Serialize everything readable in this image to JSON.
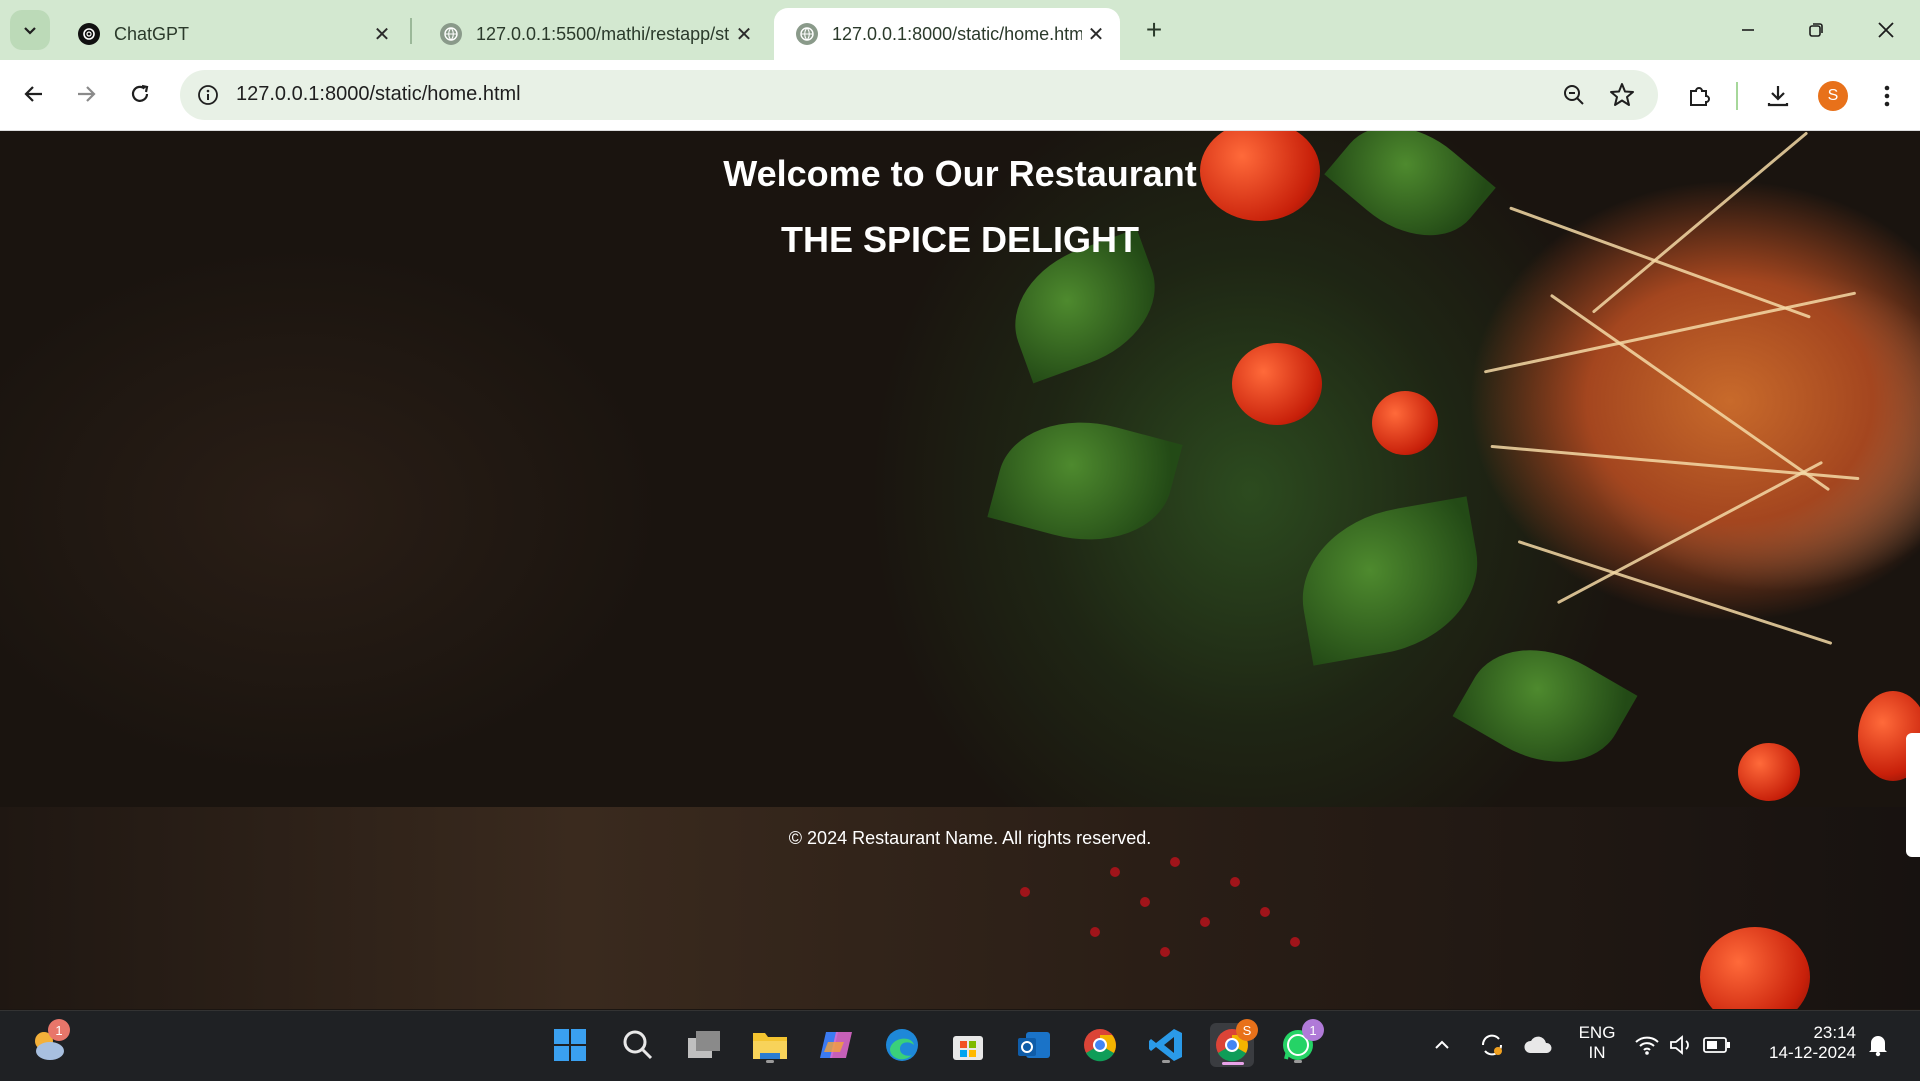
{
  "browser": {
    "tabs": [
      {
        "title": "ChatGPT",
        "active": false
      },
      {
        "title": "127.0.0.1:5500/mathi/restapp/st",
        "active": false
      },
      {
        "title": "127.0.0.1:8000/static/home.htm",
        "active": true
      }
    ],
    "url": "127.0.0.1:8000/static/home.html",
    "profile_initial": "S",
    "accent_color": "#d3e8d0"
  },
  "page": {
    "welcome": "Welcome to Our Restaurant",
    "name": "THE SPICE DELIGHT",
    "footer": "© 2024 Restaurant Name. All rights reserved."
  },
  "taskbar": {
    "weather_badge": "1",
    "chrome_profile_badge": "S",
    "whatsapp_badge": "1",
    "language_line1": "ENG",
    "language_line2": "IN",
    "time": "23:14",
    "date": "14-12-2024",
    "apps": [
      "start-icon",
      "search-icon",
      "task-view-icon",
      "file-explorer-icon",
      "copilot-icon",
      "edge-icon",
      "store-icon",
      "outlook-icon",
      "chrome-icon",
      "vscode-icon",
      "chrome-profile-icon",
      "whatsapp-icon"
    ]
  }
}
